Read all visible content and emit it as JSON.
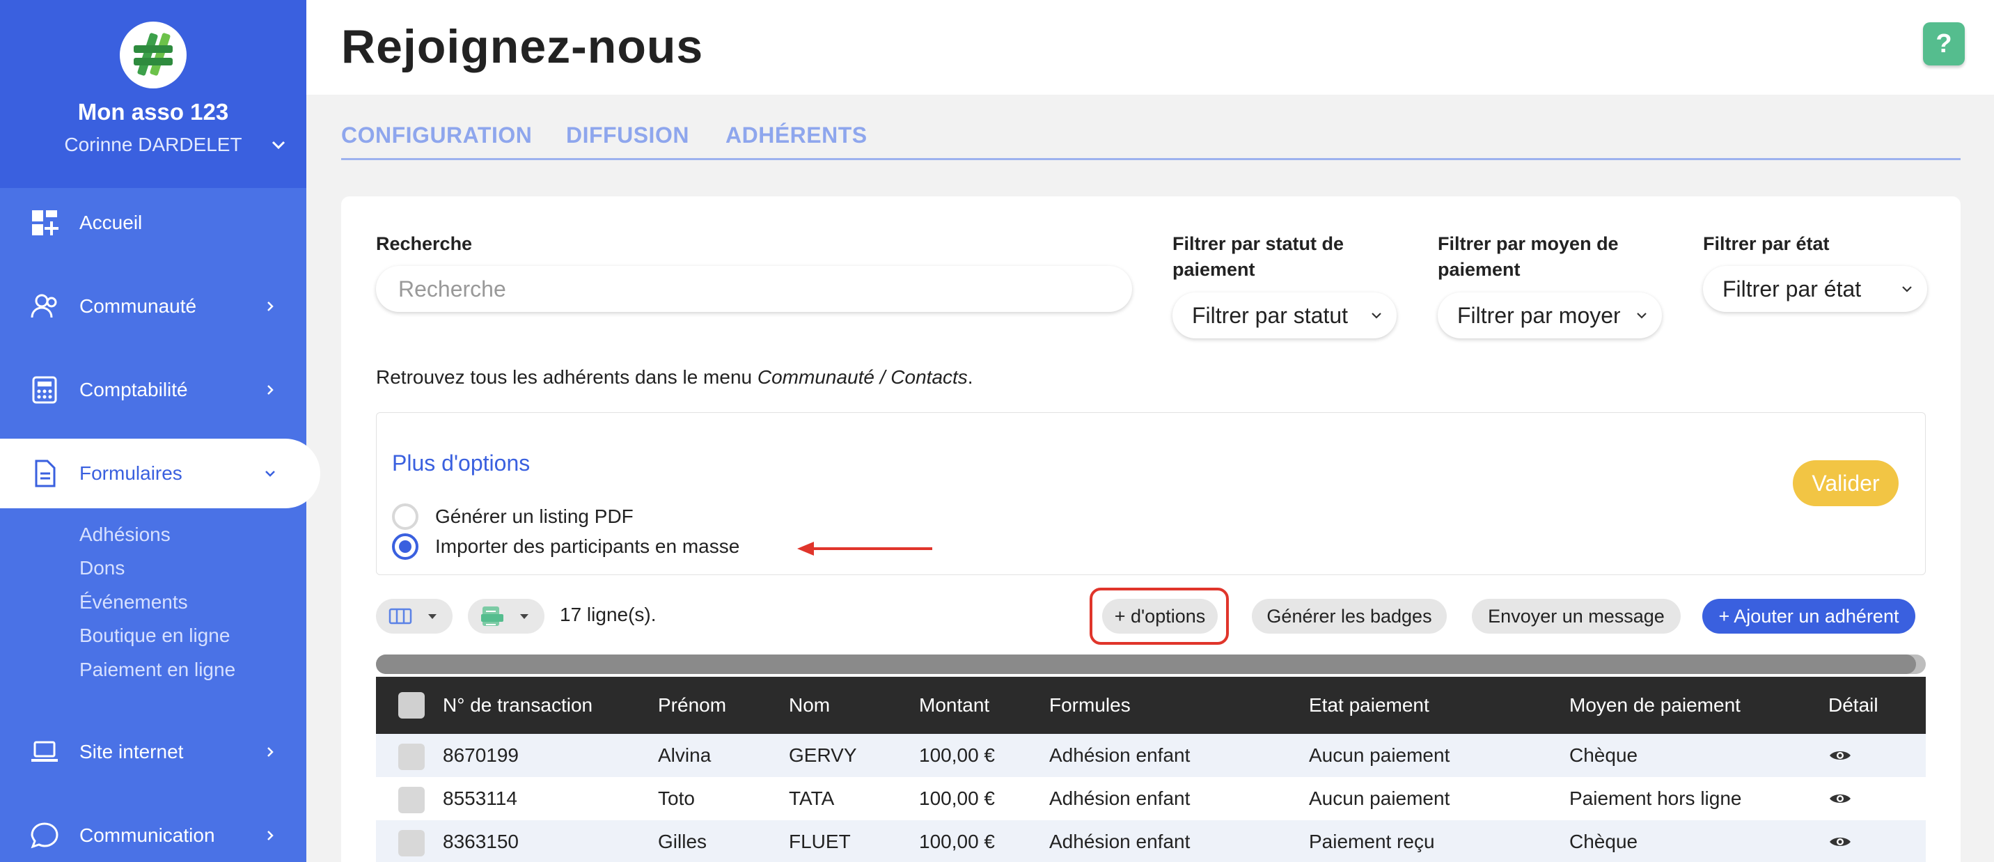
{
  "sidebar": {
    "org_name": "Mon asso 123",
    "user_name": "Corinne DARDELET",
    "nav": [
      {
        "label": "Accueil",
        "icon": "dashboard-icon"
      },
      {
        "label": "Communauté",
        "icon": "users-icon"
      },
      {
        "label": "Comptabilité",
        "icon": "calculator-icon"
      },
      {
        "label": "Formulaires",
        "icon": "document-icon"
      },
      {
        "label": "Site internet",
        "icon": "laptop-icon"
      },
      {
        "label": "Communication",
        "icon": "chat-icon"
      }
    ],
    "sub_items": [
      "Adhésions",
      "Dons",
      "Événements",
      "Boutique en ligne",
      "Paiement en ligne"
    ]
  },
  "header": {
    "title": "Rejoignez-nous",
    "help_label": "?"
  },
  "tabs": [
    "CONFIGURATION",
    "DIFFUSION",
    "ADHÉRENTS"
  ],
  "filters": {
    "search_label": "Recherche",
    "search_placeholder": "Recherche",
    "status_label": "Filtrer par statut de paiement",
    "status_value": "Filtrer par statut de paiement",
    "method_label": "Filtrer par moyen de paiement",
    "method_value": "Filtrer par moyen de paiement",
    "state_label": "Filtrer par état",
    "state_value": "Filtrer par état"
  },
  "info": {
    "text": "Retrouvez tous les adhérents dans le menu ",
    "path": "Communauté / Contacts",
    "suffix": "."
  },
  "options": {
    "title": "Plus d'options",
    "radio_pdf": "Générer un listing PDF",
    "radio_import": "Importer des participants en masse",
    "selected": "radio_import",
    "validate": "Valider"
  },
  "toolbar": {
    "row_count": "17 ligne(s).",
    "more_options": "+ d'options",
    "badges": "Générer les badges",
    "message": "Envoyer un message",
    "add": "+ Ajouter un adhérent"
  },
  "table": {
    "columns": [
      "N° de transaction",
      "Prénom",
      "Nom",
      "Montant",
      "Formules",
      "Etat paiement",
      "Moyen de paiement",
      "Détail"
    ],
    "rows": [
      [
        "8670199",
        "Alvina",
        "GERVY",
        "100,00 €",
        "Adhésion enfant",
        "Aucun paiement",
        "Chèque"
      ],
      [
        "8553114",
        "Toto",
        "TATA",
        "100,00 €",
        "Adhésion enfant",
        "Aucun paiement",
        "Paiement hors ligne"
      ],
      [
        "8363150",
        "Gilles",
        "FLUET",
        "100,00 €",
        "Adhésion enfant",
        "Paiement reçu",
        "Chèque"
      ]
    ]
  },
  "colors": {
    "brand_blue": "#3a60df",
    "sidebar_blue": "#4a72e6",
    "validate_yellow": "#f2c544",
    "help_green": "#55bd8e",
    "highlight_red": "#e0352b"
  }
}
